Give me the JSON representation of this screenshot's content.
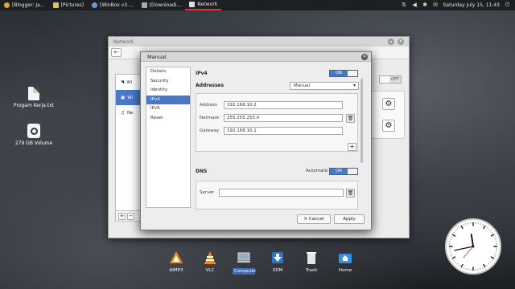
{
  "topbar": {
    "tasks": [
      {
        "label": "[Blogger: Ja...",
        "color": "#e0a43a"
      },
      {
        "label": "[Pictures]",
        "color": "#d8c170"
      },
      {
        "label": "[WinBox v3....",
        "color": "#6a9be0"
      },
      {
        "label": "[Downloadi...",
        "color": "#aaaaaa"
      },
      {
        "label": "Network",
        "color": "#eeeeee"
      }
    ],
    "datetime": "Saturday July 15, 11:43",
    "tray_icons": [
      "network-icon",
      "volume-icon",
      "bluetooth-icon",
      "message-icon",
      "power-icon"
    ]
  },
  "desktop": {
    "icons": [
      {
        "label": "Progam Kerja.txt"
      },
      {
        "label": "279 GB Volume"
      }
    ]
  },
  "network_window": {
    "title": "Network",
    "list": [
      {
        "label": "Wi",
        "icon": "wifi-icon"
      },
      {
        "label": "Wi",
        "icon": "wired-icon"
      },
      {
        "label": "Ne",
        "icon": "network-proxy-icon"
      }
    ],
    "toggle_label": "OFF"
  },
  "dialog": {
    "title": "Manual",
    "sidebar": [
      "Details",
      "Security",
      "Identity",
      "IPv4",
      "IPv6",
      "Reset"
    ],
    "ipv4_header": "IPv4",
    "ipv4_toggle": "ON",
    "addresses_label": "Addresses",
    "method": "Manual",
    "fields": [
      {
        "label": "Address",
        "value": "192.168.10.2"
      },
      {
        "label": "Netmask",
        "value": "255.255.255.0"
      },
      {
        "label": "Gateway",
        "value": "192.168.10.1"
      }
    ],
    "dns_label": "DNS",
    "dns_auto_label": "Automatic",
    "dns_toggle": "ON",
    "server_label": "Server",
    "server_value": "",
    "cancel_label": "✕ Cancel",
    "apply_label": "Apply"
  },
  "dock": {
    "items": [
      {
        "label": "AIMP3"
      },
      {
        "label": "VLC"
      },
      {
        "label": "Computer"
      },
      {
        "label": "XDM"
      },
      {
        "label": "Trash"
      },
      {
        "label": "Home"
      }
    ]
  },
  "clock": {
    "time": "11:43"
  }
}
